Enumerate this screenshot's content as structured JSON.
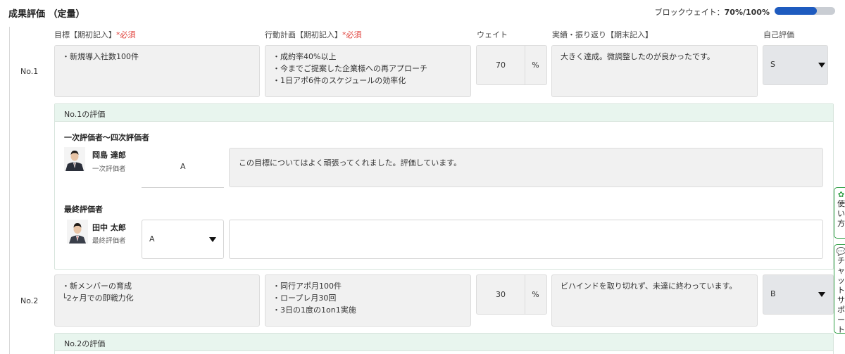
{
  "header": {
    "title": "成果評価 （定量）",
    "block_weight_label": "ブロックウェイト：",
    "block_weight_value": "70%/100%",
    "block_weight_fraction": 0.7
  },
  "columns": {
    "goal": "目標【期初記入】",
    "goal_req": "*必須",
    "plan": "行動計画【期初記入】",
    "plan_req": "*必須",
    "weight": "ウェイト",
    "result": "実績・振り返り【期末記入】",
    "self": "自己評価"
  },
  "rows": [
    {
      "no": "No.1",
      "goal": [
        "・新規導入社数100件"
      ],
      "plan": [
        "・成約率40%以上",
        "・今までご提案した企業様への再アプローチ",
        "・1日アポ6件のスケジュールの効率化"
      ],
      "weight": "70",
      "unit": "%",
      "result": "大きく達成。微調整したのが良かったです。",
      "self_grade": "S",
      "eval_title": "No.1の評価"
    },
    {
      "no": "No.2",
      "goal": [
        "・新メンバーの育成",
        "└2ヶ月での即戦力化"
      ],
      "plan": [
        "・同行アポ月100件",
        "・ロープレ月30回",
        "・3日の1度の1on1実施"
      ],
      "weight": "30",
      "unit": "%",
      "result": "ビハインドを取り切れず、未達に終わっています。",
      "self_grade": "B",
      "eval_title": "No.2の評価"
    }
  ],
  "evaluation": {
    "primary_label": "一次評価者〜四次評価者",
    "primary": {
      "name": "岡島 達郎",
      "role": "一次評価者",
      "grade": "A",
      "comment": "この目標についてはよく頑張ってくれました。評価しています。"
    },
    "final_label": "最終評価者",
    "final": {
      "name": "田中 太郎",
      "role": "最終評価者",
      "grade": "A",
      "comment": ""
    }
  },
  "side_tabs": {
    "usage": "使い方",
    "chat": "チャットサポート"
  }
}
